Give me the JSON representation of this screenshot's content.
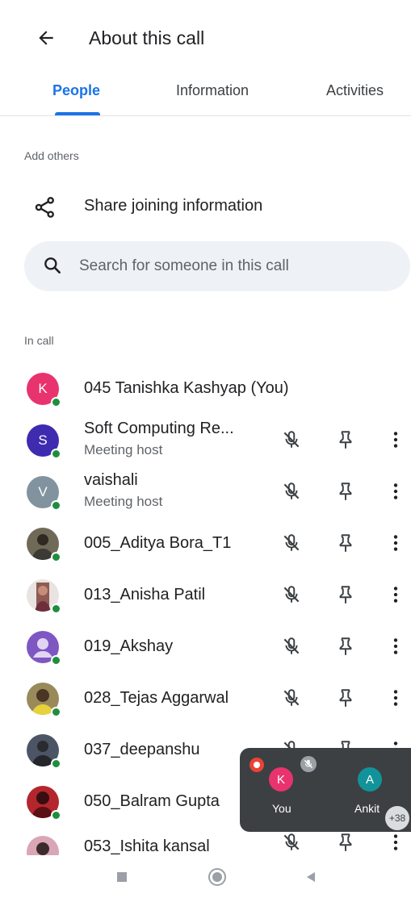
{
  "header": {
    "title": "About this call"
  },
  "tabs": [
    {
      "label": "People",
      "active": true
    },
    {
      "label": "Information",
      "active": false
    },
    {
      "label": "Activities",
      "active": false
    }
  ],
  "add_others": {
    "label": "Add others",
    "share_label": "Share joining information"
  },
  "search": {
    "placeholder": "Search for someone in this call",
    "value": ""
  },
  "in_call": {
    "label": "In call",
    "participants": [
      {
        "name": "045 Tanishka Kashyap (You)",
        "role": "",
        "initial": "K",
        "avatar_color": "#e8336f",
        "is_you": true
      },
      {
        "name": "Soft Computing Re...",
        "role": "Meeting host",
        "initial": "S",
        "avatar_color": "#3f2bb0"
      },
      {
        "name": "vaishali",
        "role": "Meeting host",
        "initial": "V",
        "avatar_color": "#80939e"
      },
      {
        "name": "005_Aditya Bora_T1",
        "role": "",
        "initial": "",
        "avatar_color": "#6f6a58"
      },
      {
        "name": "013_Anisha Patil",
        "role": "",
        "initial": "",
        "avatar_color": "#8d5b52"
      },
      {
        "name": "019_Akshay",
        "role": "",
        "initial": "",
        "avatar_color": "#7e57c2"
      },
      {
        "name": "028_Tejas Aggarwal",
        "role": "",
        "initial": "",
        "avatar_color": "#9a8a5a"
      },
      {
        "name": "037_deepanshu",
        "role": "",
        "initial": "",
        "avatar_color": "#4c5566"
      },
      {
        "name": "050_Balram Gupta",
        "role": "",
        "initial": "",
        "avatar_color": "#b3262e"
      },
      {
        "name": "053_Ishita kansal",
        "role": "",
        "initial": "",
        "avatar_color": "#d9a6b6"
      }
    ]
  },
  "mini_call": {
    "tiles": [
      {
        "label": "You",
        "initial": "K",
        "color": "#e8336f"
      },
      {
        "label": "Ankit",
        "initial": "A",
        "color": "#12939a"
      }
    ],
    "extra_count": "+38"
  },
  "colors": {
    "accent": "#1a73e8",
    "online": "#1e8e3e",
    "icon": "#3c4043"
  }
}
